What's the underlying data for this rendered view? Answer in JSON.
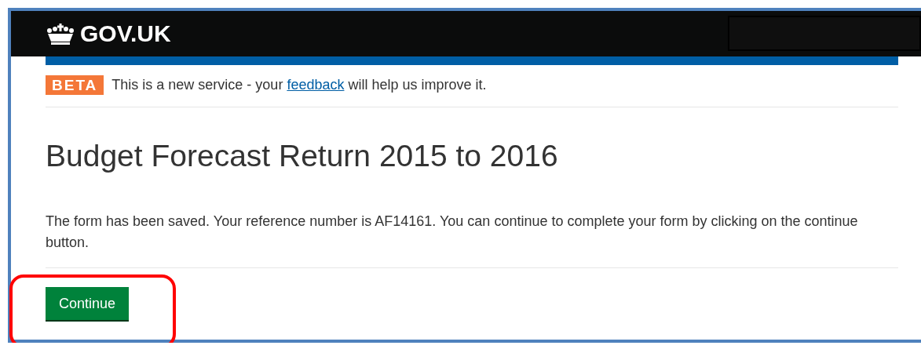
{
  "header": {
    "logo_text": "GOV.UK"
  },
  "phase_banner": {
    "tag": "BETA",
    "text_before": "This is a new service - your ",
    "link": "feedback",
    "text_after": " will help us improve it."
  },
  "heading": "Budget Forecast Return 2015 to 2016",
  "message": "The form has been saved. Your reference number is AF14161. You can continue to complete your form by clicking on the continue button.",
  "buttons": [
    {
      "label": "Continue",
      "highlighted": true
    }
  ]
}
